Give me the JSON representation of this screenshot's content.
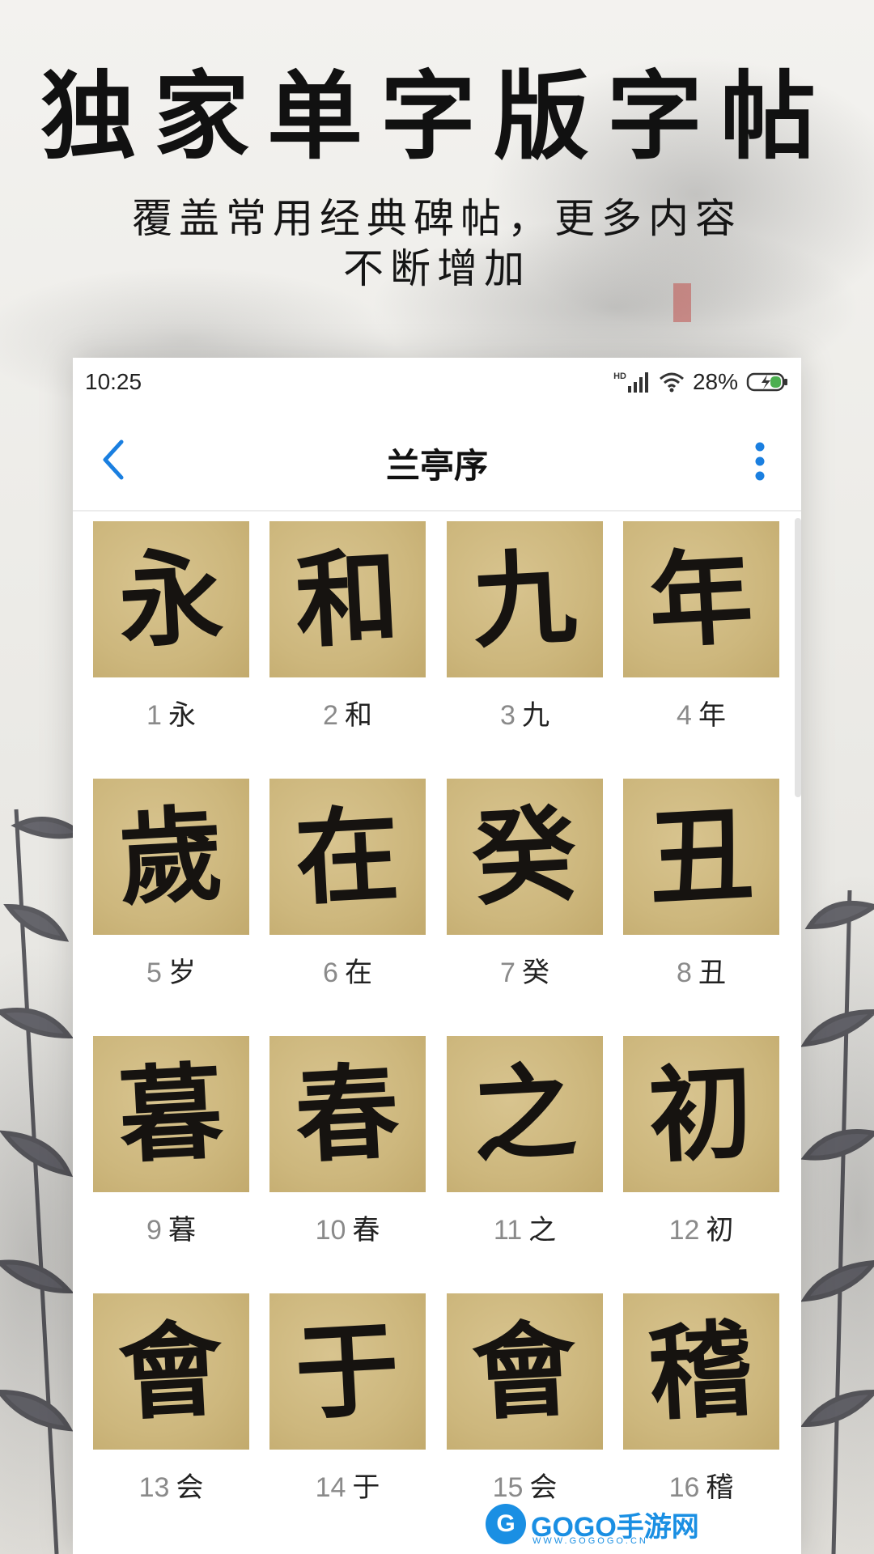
{
  "promo": {
    "headline": "独家单字版字帖",
    "subline_1": "覆盖常用经典碑帖，更多内容",
    "subline_2": "不断增加"
  },
  "status_bar": {
    "time": "10:25",
    "network": "HD",
    "battery": "28%",
    "icons": [
      "signal-icon",
      "wifi-icon",
      "battery-charging-icon"
    ]
  },
  "app_bar": {
    "title": "兰亭序",
    "back_icon": "back-chevron-icon",
    "more_icon": "more-vertical-icon",
    "accent_color": "#1a7fe0"
  },
  "characters": [
    {
      "index": "1",
      "char": "永",
      "glyph": "永"
    },
    {
      "index": "2",
      "char": "和",
      "glyph": "和"
    },
    {
      "index": "3",
      "char": "九",
      "glyph": "九"
    },
    {
      "index": "4",
      "char": "年",
      "glyph": "年"
    },
    {
      "index": "5",
      "char": "岁",
      "glyph": "歲"
    },
    {
      "index": "6",
      "char": "在",
      "glyph": "在"
    },
    {
      "index": "7",
      "char": "癸",
      "glyph": "癸"
    },
    {
      "index": "8",
      "char": "丑",
      "glyph": "丑"
    },
    {
      "index": "9",
      "char": "暮",
      "glyph": "暮"
    },
    {
      "index": "10",
      "char": "春",
      "glyph": "春"
    },
    {
      "index": "11",
      "char": "之",
      "glyph": "之"
    },
    {
      "index": "12",
      "char": "初",
      "glyph": "初"
    },
    {
      "index": "13",
      "char": "会",
      "glyph": "會"
    },
    {
      "index": "14",
      "char": "于",
      "glyph": "于"
    },
    {
      "index": "15",
      "char": "会",
      "glyph": "會"
    },
    {
      "index": "16",
      "char": "稽",
      "glyph": "稽"
    }
  ],
  "watermark": {
    "logo_letter": "G",
    "text": "GOGO手游网",
    "sub": "WWW.GOGOGO.CN"
  }
}
